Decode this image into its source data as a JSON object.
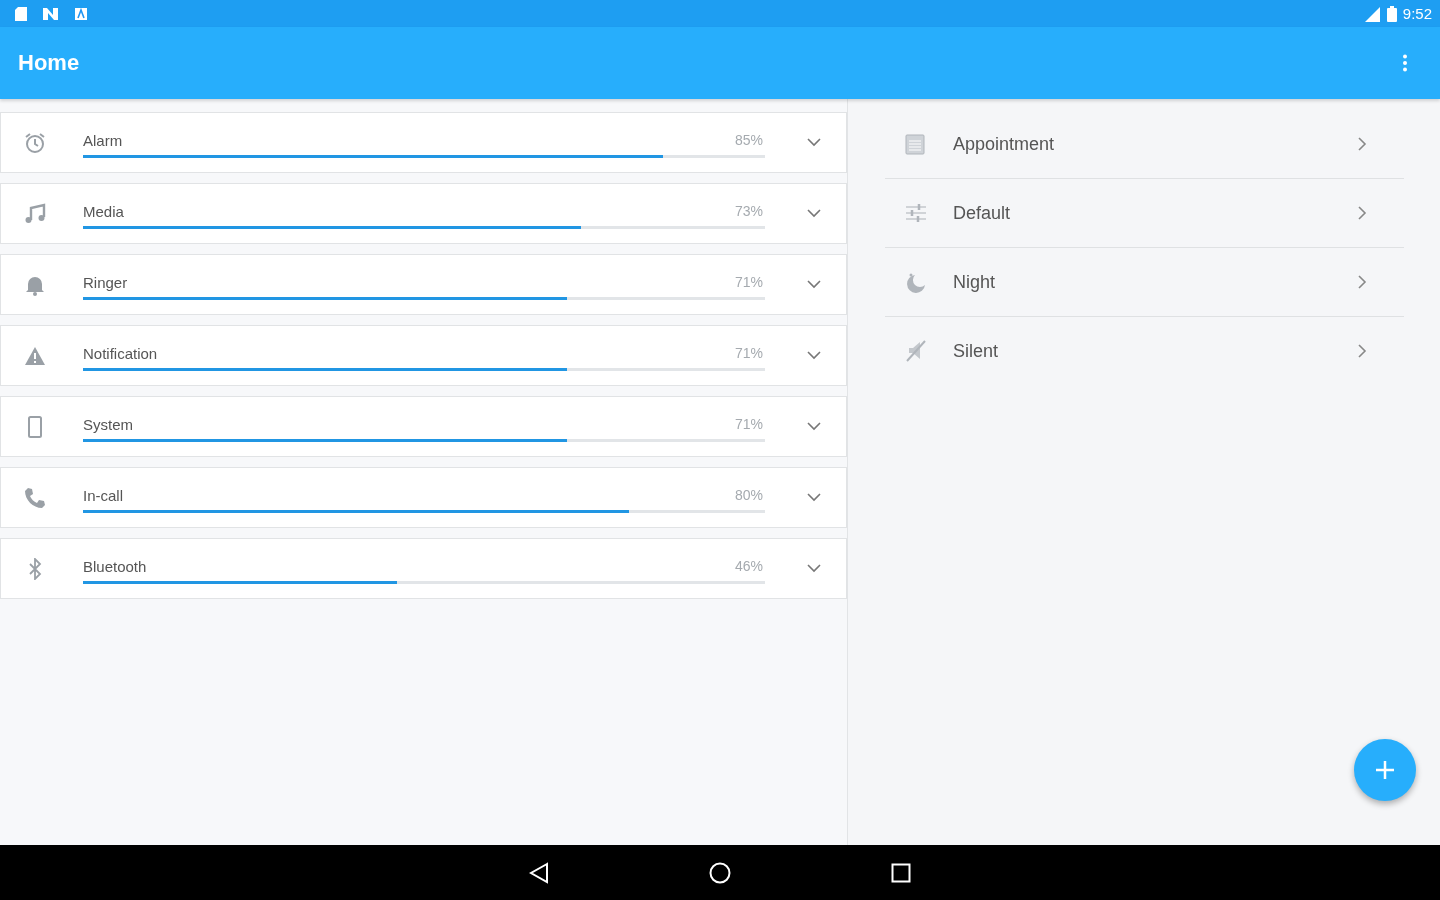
{
  "status_bar": {
    "time": "9:52"
  },
  "app_bar": {
    "title": "Home"
  },
  "channels": [
    {
      "name": "Alarm",
      "level": 0.85,
      "reading": "85%"
    },
    {
      "name": "Media",
      "level": 0.73,
      "reading": "73%"
    },
    {
      "name": "Ringer",
      "level": 0.71,
      "reading": "71%"
    },
    {
      "name": "Notification",
      "level": 0.71,
      "reading": "71%"
    },
    {
      "name": "System",
      "level": 0.71,
      "reading": "71%"
    },
    {
      "name": "In-call",
      "level": 0.8,
      "reading": "80%"
    },
    {
      "name": "Bluetooth",
      "level": 0.46,
      "reading": "46%"
    }
  ],
  "profiles": [
    {
      "name": "Appointment"
    },
    {
      "name": "Default"
    },
    {
      "name": "Night"
    },
    {
      "name": "Silent"
    }
  ]
}
